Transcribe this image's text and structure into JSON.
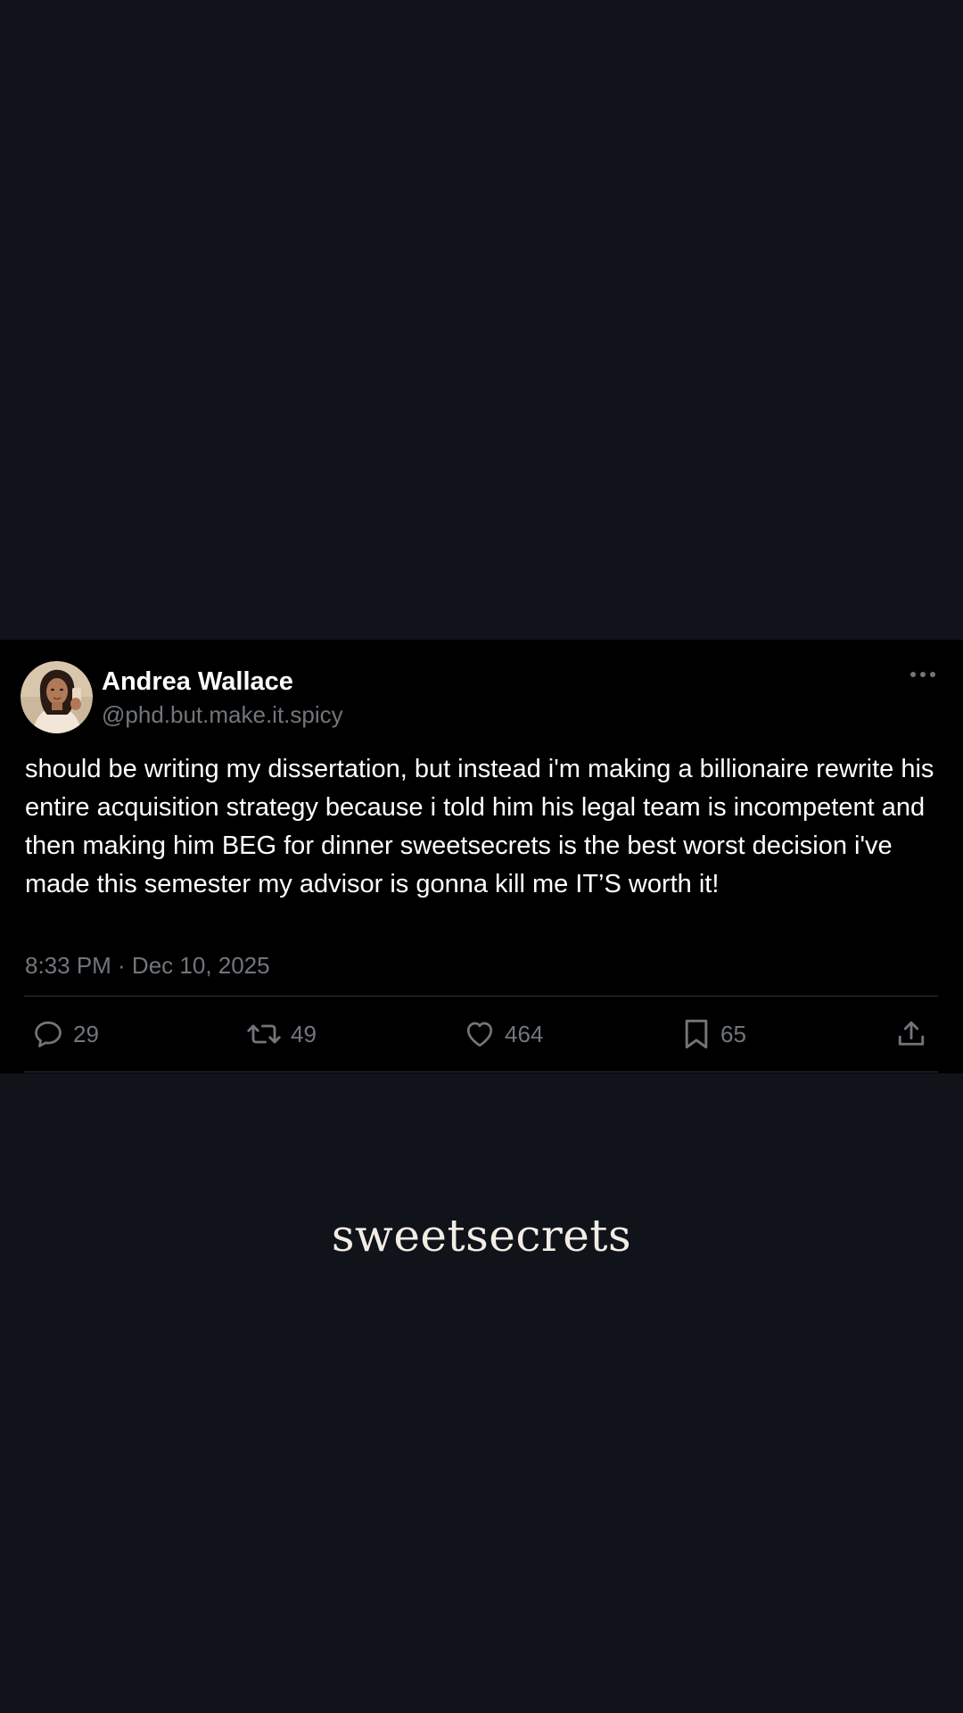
{
  "tweet": {
    "author": {
      "display_name": "Andrea Wallace",
      "handle": "@phd.but.make.it.spicy"
    },
    "text": "should be writing my dissertation, but instead i'm making a billionaire rewrite his entire acquisition strategy because i told him his legal team is incompetent and then making him BEG for dinner sweetsecrets is the best worst decision i've made this semester my advisor is gonna kill me IT’S worth it!",
    "timestamp": "8:33 PM · Dec 10, 2025",
    "stats": {
      "replies": "29",
      "retweets": "49",
      "likes": "464",
      "bookmarks": "65"
    },
    "icons": {
      "more": "more-horizontal-icon",
      "reply": "reply-icon",
      "retweet": "retweet-icon",
      "like": "heart-icon",
      "bookmark": "bookmark-icon",
      "share": "share-icon"
    }
  },
  "brand": {
    "name": "sweetsecrets"
  },
  "colors": {
    "page_background": "#10131a",
    "card_background": "#000000",
    "primary_text": "#ffffff",
    "secondary_text": "#71767b",
    "divider": "#2f3336",
    "brand_text": "#f2ede4"
  }
}
